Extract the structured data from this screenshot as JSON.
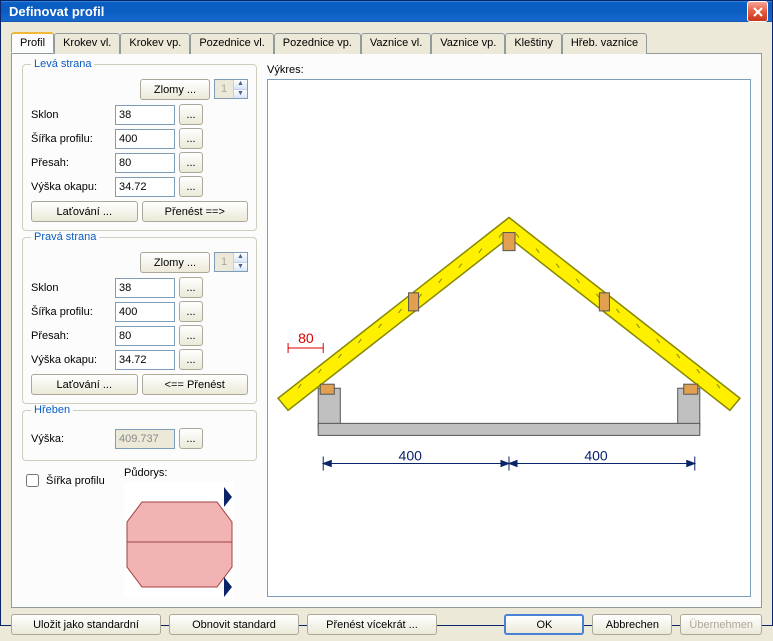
{
  "window": {
    "title": "Definovat profil"
  },
  "tabs": [
    "Profil",
    "Krokev vl.",
    "Krokev vp.",
    "Pozednice vl.",
    "Pozednice vp.",
    "Vaznice vl.",
    "Vaznice vp.",
    "Kleštiny",
    "Hřeb. vaznice"
  ],
  "left": {
    "group": {
      "legend": "Levá strana",
      "zlomy_btn": "Zlomy ...",
      "spin_val": "1",
      "sklon_lbl": "Sklon",
      "sklon": "38",
      "sirka_lbl": "Šířka profilu:",
      "sirka": "400",
      "presah_lbl": "Přesah:",
      "presah": "80",
      "vyska_lbl": "Výška okapu:",
      "vyska": "34.72",
      "latovani_btn": "Laťování ...",
      "prenest_btn": "Přenést ==>"
    }
  },
  "right": {
    "group": {
      "legend": "Pravá strana",
      "zlomy_btn": "Zlomy ...",
      "spin_val": "1",
      "sklon_lbl": "Sklon",
      "sklon": "38",
      "sirka_lbl": "Šířka profilu:",
      "sirka": "400",
      "presah_lbl": "Přesah:",
      "presah": "80",
      "vyska_lbl": "Výška okapu:",
      "vyska": "34.72",
      "latovani_btn": "Laťování ...",
      "prenest_btn": "<== Přenést"
    }
  },
  "hreben": {
    "legend": "Hřeben",
    "vyska_lbl": "Výška:",
    "vyska": "409.737"
  },
  "sirka_check_lbl": "Šířka profilu",
  "pudorys_lbl": "Půdorys:",
  "vykres_lbl": "Výkres:",
  "drawing": {
    "dim_presah": "80",
    "dim_width1": "400",
    "dim_width2": "400"
  },
  "footer": {
    "ulozit": "Uložit jako standardní",
    "obnovit": "Obnovit standard",
    "prenest": "Přenést vícekrát ...",
    "ok": "OK",
    "cancel": "Abbrechen",
    "apply": "Übernehmen"
  },
  "ellipsis": "..."
}
